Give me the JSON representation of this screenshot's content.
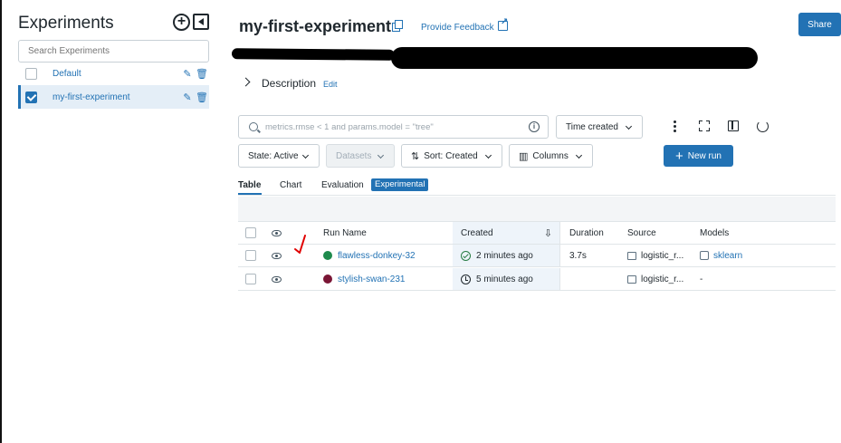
{
  "sidebar": {
    "title": "Experiments",
    "search_placeholder": "Search Experiments",
    "items": [
      {
        "label": "Default",
        "selected": false
      },
      {
        "label": "my-first-experiment",
        "selected": true
      }
    ]
  },
  "header": {
    "title": "my-first-experiment",
    "feedback_label": "Provide Feedback",
    "share_label": "Share"
  },
  "description": {
    "label": "Description",
    "edit_label": "Edit"
  },
  "filters": {
    "search_placeholder": "metrics.rmse < 1 and params.model = \"tree\"",
    "time_label": "Time created",
    "state_label": "State: Active",
    "datasets_label": "Datasets",
    "sort_label": "Sort: Created",
    "columns_label": "Columns",
    "new_run_label": "New run"
  },
  "tabs": [
    {
      "label": "Table",
      "active": true
    },
    {
      "label": "Chart",
      "active": false
    },
    {
      "label": "Evaluation",
      "active": false
    },
    {
      "label": "Experimental",
      "badge": true
    }
  ],
  "table": {
    "columns": [
      "Run Name",
      "Created",
      "Duration",
      "Source",
      "Models"
    ],
    "rows": [
      {
        "name": "flawless-donkey-32",
        "color": "#1e8a4c",
        "created": "2 minutes ago",
        "status": "finished",
        "duration": "3.7s",
        "source": "logistic_r...",
        "model": "sklearn"
      },
      {
        "name": "stylish-swan-231",
        "color": "#7a1535",
        "created": "5 minutes ago",
        "status": "running",
        "duration": "",
        "source": "logistic_r...",
        "model": "-"
      }
    ]
  },
  "colors": {
    "primary": "#2272b4",
    "annotation": "#e00000"
  }
}
